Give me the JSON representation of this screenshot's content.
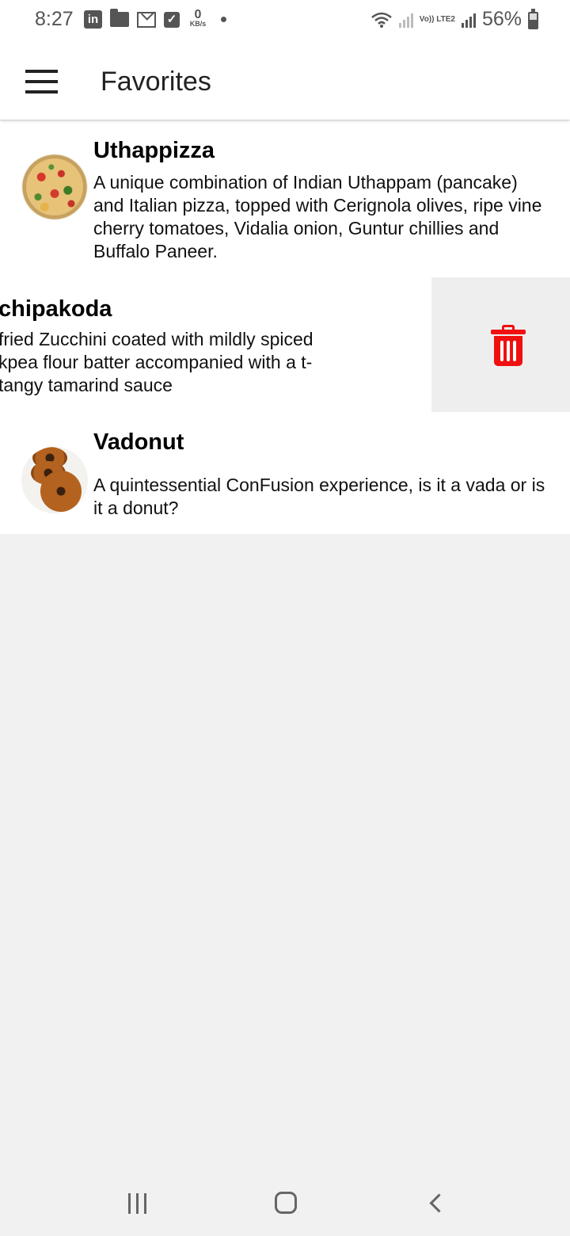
{
  "status_bar": {
    "time": "8:27",
    "notification_icons": [
      "linkedin-icon",
      "folder-icon",
      "gmail-icon",
      "check-icon"
    ],
    "net_speed_value": "0",
    "net_speed_unit": "KB/s",
    "volte_label": "Vo)) LTE2",
    "battery_percent": "56%"
  },
  "app_bar": {
    "title": "Favorites"
  },
  "favorites": [
    {
      "name": "Uthappizza",
      "description": "A unique combination of Indian Uthappam (pancake) and Italian pizza, topped with Cerignola olives, ripe vine cherry tomatoes, Vidalia onion, Guntur chillies and Buffalo Paneer."
    },
    {
      "name": "chipakoda",
      "description": "fried Zucchini coated with mildly spiced kpea flour batter accompanied with a t-tangy tamarind sauce"
    },
    {
      "name": "Vadonut",
      "description": "A quintessential ConFusion experience, is it a vada or is it a donut?"
    }
  ],
  "swipe_action": {
    "icon": "trash-icon",
    "color": "#f01010"
  },
  "nav_bar": {
    "icons": [
      "recent-apps-icon",
      "home-icon",
      "back-icon"
    ]
  }
}
